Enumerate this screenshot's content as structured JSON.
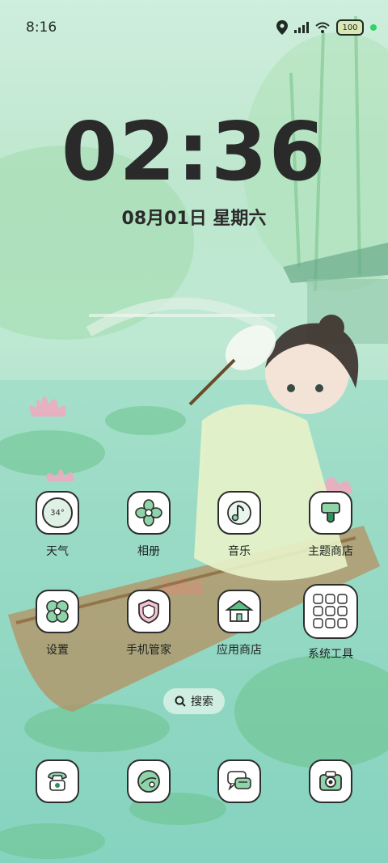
{
  "status_bar": {
    "time": "8:16",
    "battery": "100",
    "icons": [
      "location-icon",
      "signal-icon",
      "wifi-icon",
      "battery-icon"
    ]
  },
  "lockscreen": {
    "clock": "02:36",
    "date": "08月01日 星期六"
  },
  "apps_row1": [
    {
      "label": "天气",
      "icon": "weather-icon",
      "icon_text": "34°"
    },
    {
      "label": "相册",
      "icon": "gallery-icon"
    },
    {
      "label": "音乐",
      "icon": "music-icon"
    },
    {
      "label": "主题商店",
      "icon": "theme-store-icon"
    }
  ],
  "apps_row2": [
    {
      "label": "设置",
      "icon": "settings-icon"
    },
    {
      "label": "手机管家",
      "icon": "phone-manager-icon"
    },
    {
      "label": "应用商店",
      "icon": "app-store-icon"
    },
    {
      "label": "系统工具",
      "icon": "system-tools-folder-icon"
    }
  ],
  "search": {
    "label": "搜索",
    "icon": "search-icon"
  },
  "dock": [
    {
      "icon": "phone-icon"
    },
    {
      "icon": "browser-icon"
    },
    {
      "icon": "messages-icon"
    },
    {
      "icon": "camera-icon"
    }
  ],
  "colors": {
    "accent_green": "#2f8f5b",
    "icon_outline": "#2d2d2d",
    "wallpaper_base": "#bde8d2"
  }
}
